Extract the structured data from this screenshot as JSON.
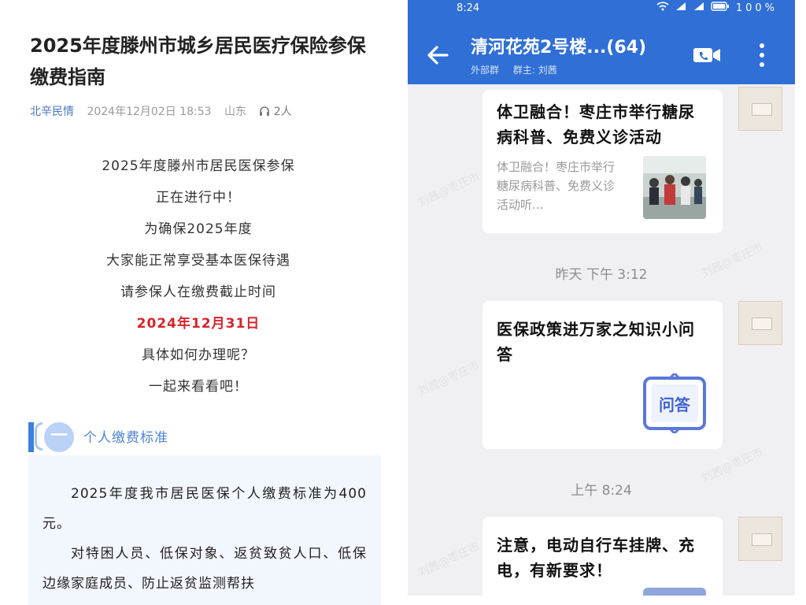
{
  "article": {
    "title": "2025年度滕州市城乡居民医疗保险参保缴费指南",
    "meta": {
      "author": "北辛民情",
      "date": "2024年12月02日 18:53",
      "region": "山东",
      "reader_count": "2人",
      "reader_icon": "headphone-icon"
    },
    "intro_lines": [
      "2025年度滕州市居民医保参保",
      "正在进行中！",
      "为确保2025年度",
      "大家能正常享受基本医保待遇",
      "请参保人在缴费截止时间",
      "2024年12月31日",
      "具体如何办理呢？",
      "一起来看看吧！"
    ],
    "section": {
      "number": "一",
      "label": "个人缴费标准",
      "paragraph1": "2025年度我市居民医保个人缴费标准为400元。",
      "paragraph2": "对特困人员、低保对象、返贫致贫人口、低保边缘家庭成员、防止返贫监测帮扶"
    },
    "colors": {
      "deadline": "#d8232a",
      "accent": "#3c7fe0",
      "section_bg": "#f2f6fd"
    }
  },
  "chat": {
    "status_time": "8:24",
    "status_battery": "100%",
    "title": "清河花苑2号楼...(64)",
    "subtitle_tag": "外部群",
    "subtitle_owner": "群主: 刘茜",
    "messages": [
      {
        "title": "体卫融合！枣庄市举行糖尿病科普、免费义诊活动",
        "desc": "体卫融合！枣庄市举行糖尿病科普、免费义诊活动听..."
      },
      {
        "timestamp": "昨天 下午 3:12",
        "title": "医保政策进万家之知识小问答",
        "icon_label": "问答"
      },
      {
        "timestamp": "上午 8:24",
        "title": "注意，电动自行车挂牌、充电，有新要求！"
      }
    ],
    "colors": {
      "appbar": "#2f6fd6",
      "background": "#f0f0f2"
    }
  }
}
